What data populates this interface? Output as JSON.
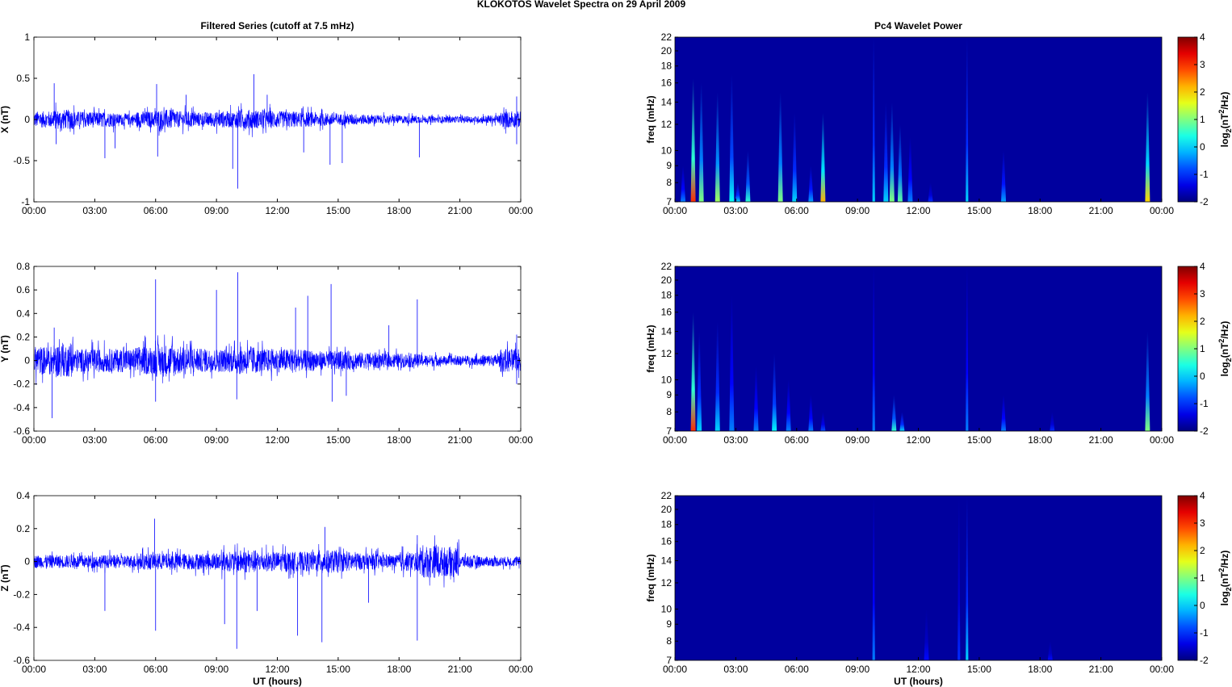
{
  "title": "KLOKOTOS Wavelet Spectra on 29 April     2009",
  "chart_data": [
    {
      "type": "line",
      "title": "Filtered Series (cutoff at 7.5 mHz)",
      "ylabel": "X (nT)",
      "xlabel": "",
      "xlim": [
        0,
        24
      ],
      "ylim": [
        -1,
        1
      ],
      "xticks": [
        "00:00",
        "03:00",
        "06:00",
        "09:00",
        "12:00",
        "15:00",
        "18:00",
        "21:00",
        "00:00"
      ],
      "yticks": [
        -1,
        -0.5,
        0,
        0.5,
        1
      ],
      "yticklabels": [
        "-1",
        "-0.5",
        "0",
        "0.5",
        "1"
      ],
      "color": "#0000ff",
      "noise_envelope": [
        0.1,
        0.12,
        0.1,
        0.09,
        0.07,
        0.1,
        0.12,
        0.1,
        0.09,
        0.1,
        0.12,
        0.11,
        0.1,
        0.09,
        0.08,
        0.07,
        0.06,
        0.05,
        0.05,
        0.04,
        0.04,
        0.04,
        0.05,
        0.1
      ],
      "spikes": [
        [
          1.0,
          0.44
        ],
        [
          1.1,
          -0.3
        ],
        [
          3.5,
          -0.47
        ],
        [
          6.05,
          0.43
        ],
        [
          6.1,
          -0.45
        ],
        [
          7.5,
          0.3
        ],
        [
          9.8,
          -0.6
        ],
        [
          10.05,
          -0.84
        ],
        [
          10.85,
          0.55
        ],
        [
          11.5,
          0.3
        ],
        [
          14.6,
          -0.55
        ],
        [
          15.2,
          -0.53
        ],
        [
          13.3,
          -0.4
        ],
        [
          19.0,
          -0.46
        ],
        [
          4.0,
          -0.35
        ],
        [
          23.8,
          -0.3
        ],
        [
          23.8,
          0.28
        ]
      ]
    },
    {
      "type": "line",
      "ylabel": "Y (nT)",
      "xlabel": "",
      "xlim": [
        0,
        24
      ],
      "ylim": [
        -0.6,
        0.8
      ],
      "xticks": [
        "00:00",
        "03:00",
        "06:00",
        "09:00",
        "12:00",
        "15:00",
        "18:00",
        "21:00",
        "00:00"
      ],
      "yticks": [
        -0.6,
        -0.4,
        -0.2,
        0,
        0.2,
        0.4,
        0.6,
        0.8
      ],
      "yticklabels": [
        "-0.6",
        "-0.4",
        "-0.2",
        "0",
        "0.2",
        "0.4",
        "0.6",
        "0.8"
      ],
      "color": "#0000ff",
      "noise_envelope": [
        0.12,
        0.14,
        0.1,
        0.1,
        0.1,
        0.12,
        0.14,
        0.12,
        0.1,
        0.1,
        0.12,
        0.1,
        0.1,
        0.09,
        0.08,
        0.08,
        0.07,
        0.06,
        0.06,
        0.05,
        0.04,
        0.04,
        0.05,
        0.1
      ],
      "spikes": [
        [
          0.9,
          -0.49
        ],
        [
          1.0,
          0.28
        ],
        [
          6.0,
          0.69
        ],
        [
          6.0,
          -0.35
        ],
        [
          9.0,
          0.6
        ],
        [
          10.05,
          0.75
        ],
        [
          10.0,
          -0.33
        ],
        [
          12.9,
          0.45
        ],
        [
          13.5,
          0.55
        ],
        [
          14.65,
          0.65
        ],
        [
          14.7,
          -0.35
        ],
        [
          15.4,
          -0.3
        ],
        [
          18.9,
          0.52
        ],
        [
          17.5,
          0.3
        ],
        [
          23.8,
          0.22
        ],
        [
          23.8,
          -0.2
        ]
      ]
    },
    {
      "type": "line",
      "ylabel": "Z (nT)",
      "xlabel": "UT (hours)",
      "xlim": [
        0,
        24
      ],
      "ylim": [
        -0.6,
        0.4
      ],
      "xticks": [
        "00:00",
        "03:00",
        "06:00",
        "09:00",
        "12:00",
        "15:00",
        "18:00",
        "21:00",
        "00:00"
      ],
      "yticks": [
        -0.6,
        -0.4,
        -0.2,
        0,
        0.2,
        0.4
      ],
      "yticklabels": [
        "-0.6",
        "-0.4",
        "-0.2",
        "0",
        "0.2",
        "0.4"
      ],
      "color": "#0000ff",
      "noise_envelope": [
        0.04,
        0.04,
        0.04,
        0.04,
        0.04,
        0.05,
        0.05,
        0.05,
        0.05,
        0.06,
        0.07,
        0.06,
        0.06,
        0.06,
        0.07,
        0.06,
        0.05,
        0.04,
        0.06,
        0.1,
        0.09,
        0.04,
        0.03,
        0.03
      ],
      "spikes": [
        [
          3.5,
          -0.3
        ],
        [
          5.95,
          0.26
        ],
        [
          6.0,
          -0.42
        ],
        [
          9.4,
          -0.38
        ],
        [
          10.0,
          -0.53
        ],
        [
          13.0,
          -0.45
        ],
        [
          14.2,
          -0.49
        ],
        [
          14.35,
          0.21
        ],
        [
          18.9,
          -0.48
        ],
        [
          18.9,
          0.16
        ],
        [
          11.0,
          -0.3
        ],
        [
          16.5,
          -0.25
        ]
      ]
    }
  ],
  "spectra": [
    {
      "type": "heatmap",
      "title": "Pc4 Wavelet Power",
      "ylabel": "freq (mHz)",
      "xlabel": "",
      "xlim": [
        0,
        24
      ],
      "ylim": [
        7,
        22
      ],
      "yscale": "log",
      "xticks": [
        "00:00",
        "03:00",
        "06:00",
        "09:00",
        "12:00",
        "15:00",
        "18:00",
        "21:00",
        "00:00"
      ],
      "yticks": [
        7,
        8,
        9,
        10,
        12,
        14,
        16,
        18,
        20,
        22
      ],
      "clim": [
        -2,
        4
      ],
      "colorbar_ticks": [
        "-2",
        "-1",
        "0",
        "1",
        "2",
        "3",
        "4"
      ],
      "colorbar_label": "log2(nT2/Hz)",
      "background_power": -2,
      "bursts": [
        [
          0.4,
          9,
          -0.5
        ],
        [
          0.9,
          16.5,
          3
        ],
        [
          1.3,
          16,
          1
        ],
        [
          2.1,
          15,
          1.2
        ],
        [
          2.8,
          17,
          0.3
        ],
        [
          3.1,
          8,
          0
        ],
        [
          3.6,
          10,
          0.5
        ],
        [
          5.2,
          15,
          1
        ],
        [
          5.9,
          13,
          0
        ],
        [
          6.7,
          9,
          -0.3
        ],
        [
          7.3,
          13,
          2.2
        ],
        [
          9.8,
          22,
          0
        ],
        [
          10.4,
          14,
          0
        ],
        [
          10.7,
          14,
          1
        ],
        [
          11.1,
          12,
          0.8
        ],
        [
          11.6,
          11,
          -0.5
        ],
        [
          12.6,
          8,
          -1
        ],
        [
          14.4,
          22,
          0
        ],
        [
          16.2,
          10,
          -0.3
        ],
        [
          23.3,
          15,
          2
        ]
      ]
    },
    {
      "type": "heatmap",
      "ylabel": "freq (mHz)",
      "xlabel": "",
      "xlim": [
        0,
        24
      ],
      "ylim": [
        7,
        22
      ],
      "yscale": "log",
      "xticks": [
        "00:00",
        "03:00",
        "06:00",
        "09:00",
        "12:00",
        "15:00",
        "18:00",
        "21:00",
        "00:00"
      ],
      "yticks": [
        7,
        8,
        9,
        10,
        12,
        14,
        16,
        18,
        20,
        22
      ],
      "clim": [
        -2,
        4
      ],
      "colorbar_ticks": [
        "-2",
        "-1",
        "0",
        "1",
        "2",
        "3",
        "4"
      ],
      "colorbar_label": "log2(nT2/Hz)",
      "background_power": -2,
      "bursts": [
        [
          0.9,
          16,
          3
        ],
        [
          1.2,
          14,
          0
        ],
        [
          2.1,
          15,
          0
        ],
        [
          2.8,
          18,
          -0.5
        ],
        [
          4.0,
          11,
          -0.5
        ],
        [
          4.9,
          12,
          0.2
        ],
        [
          5.6,
          10,
          -0.5
        ],
        [
          6.7,
          9,
          -0.5
        ],
        [
          7.3,
          8,
          -0.8
        ],
        [
          9.8,
          22,
          -0.5
        ],
        [
          10.8,
          9,
          0.5
        ],
        [
          11.2,
          8,
          0
        ],
        [
          14.4,
          22,
          -0.5
        ],
        [
          16.2,
          9,
          -0.5
        ],
        [
          18.6,
          8,
          -1
        ],
        [
          23.3,
          14,
          1
        ]
      ]
    },
    {
      "type": "heatmap",
      "ylabel": "freq (mHz)",
      "xlabel": "UT (hours)",
      "xlim": [
        0,
        24
      ],
      "ylim": [
        7,
        22
      ],
      "yscale": "log",
      "xticks": [
        "00:00",
        "03:00",
        "06:00",
        "09:00",
        "12:00",
        "15:00",
        "18:00",
        "21:00",
        "00:00"
      ],
      "yticks": [
        7,
        8,
        9,
        10,
        12,
        14,
        16,
        18,
        20,
        22
      ],
      "clim": [
        -2,
        4
      ],
      "colorbar_ticks": [
        "-2",
        "-1",
        "0",
        "1",
        "2",
        "3",
        "4"
      ],
      "colorbar_label": "log2(nT2/Hz)",
      "background_power": -2,
      "bursts": [
        [
          9.8,
          22,
          -0.5
        ],
        [
          12.4,
          10,
          -1.2
        ],
        [
          14.0,
          22,
          -1
        ],
        [
          14.4,
          22,
          0
        ],
        [
          18.5,
          8,
          -1.2
        ]
      ]
    }
  ]
}
